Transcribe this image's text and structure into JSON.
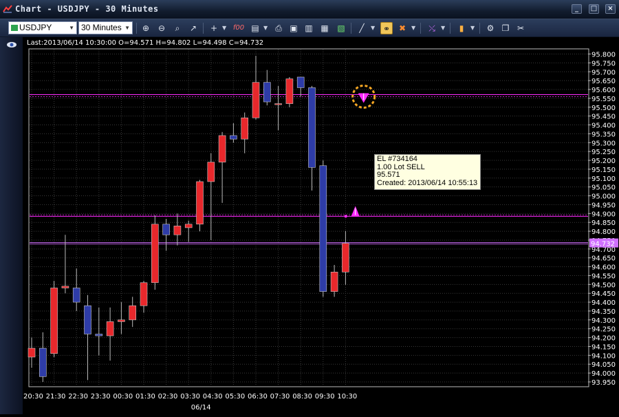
{
  "window": {
    "title": "Chart - USDJPY - 30 Minutes"
  },
  "toolbar": {
    "symbol": "USDJPY",
    "timeframe": "30 Minutes",
    "tools": [
      "zoom-in",
      "zoom-out",
      "zoom-fit",
      "cursor",
      "crosshair",
      "fx-indicators",
      "chart-type",
      "print",
      "save",
      "properties",
      "export",
      "line-tool",
      "link-tool",
      "delete-tool",
      "trendline",
      "candlestick",
      "settings",
      "copy",
      "tools"
    ]
  },
  "status_line": "Last:2013/06/14 10:30:00 O=94.571 H=94.802 L=94.498 C=94.732",
  "price_axis": {
    "min": 93.95,
    "max": 95.8,
    "step": 0.05,
    "labels": [
      "95.800",
      "95.750",
      "95.700",
      "95.650",
      "95.600",
      "95.550",
      "95.500",
      "95.450",
      "95.400",
      "95.350",
      "95.300",
      "95.250",
      "95.200",
      "95.150",
      "95.100",
      "95.050",
      "95.000",
      "94.950",
      "94.900",
      "94.850",
      "94.800",
      "94.750",
      "94.700",
      "94.650",
      "94.600",
      "94.550",
      "94.500",
      "94.450",
      "94.400",
      "94.350",
      "94.300",
      "94.250",
      "94.200",
      "94.150",
      "94.100",
      "94.050",
      "94.000",
      "93.950"
    ]
  },
  "current_price": {
    "value": 94.732,
    "label": "94.732"
  },
  "order_line": {
    "price": 95.571
  },
  "entry_line": {
    "price": 94.884
  },
  "time_axis": {
    "labels": [
      "20:30",
      "21:30",
      "22:30",
      "23:30",
      "00:30",
      "01:30",
      "02:30",
      "03:30",
      "04:30",
      "05:30",
      "06:30",
      "07:30",
      "08:30",
      "09:30",
      "10:30"
    ],
    "date_label": "06/14",
    "date_label_index": 8
  },
  "tooltip": {
    "line1": "EL #734164",
    "line2": "1.00 Lot SELL",
    "line3": "95.571",
    "line4": "Created: 2013/06/14 10:55:13"
  },
  "colors": {
    "bull": "#e8282c",
    "bear": "#2e3ca8",
    "marker": "#ff2bff",
    "order_circle": "#f5a623",
    "grid": "#3a3a3a"
  },
  "chart_data": {
    "type": "candlestick",
    "symbol": "USDJPY",
    "timeframe": "30 Minutes",
    "candles": [
      {
        "t": "20:00",
        "o": 94.09,
        "h": 94.2,
        "l": 94.03,
        "c": 94.14
      },
      {
        "t": "20:30",
        "o": 94.14,
        "h": 94.23,
        "l": 93.95,
        "c": 93.98
      },
      {
        "t": "21:00",
        "o": 94.11,
        "h": 94.52,
        "l": 94.09,
        "c": 94.48
      },
      {
        "t": "21:30",
        "o": 94.48,
        "h": 94.78,
        "l": 94.45,
        "c": 94.49
      },
      {
        "t": "22:00",
        "o": 94.48,
        "h": 94.59,
        "l": 94.35,
        "c": 94.4
      },
      {
        "t": "22:30",
        "o": 94.38,
        "h": 94.44,
        "l": 93.96,
        "c": 94.22
      },
      {
        "t": "23:00",
        "o": 94.22,
        "h": 94.37,
        "l": 94.1,
        "c": 94.21
      },
      {
        "t": "23:30",
        "o": 94.21,
        "h": 94.37,
        "l": 94.07,
        "c": 94.29
      },
      {
        "t": "00:00",
        "o": 94.29,
        "h": 94.4,
        "l": 94.22,
        "c": 94.3
      },
      {
        "t": "00:30",
        "o": 94.3,
        "h": 94.43,
        "l": 94.26,
        "c": 94.38
      },
      {
        "t": "01:00",
        "o": 94.38,
        "h": 94.52,
        "l": 94.34,
        "c": 94.51
      },
      {
        "t": "01:30",
        "o": 94.51,
        "h": 94.89,
        "l": 94.47,
        "c": 94.84
      },
      {
        "t": "02:00",
        "o": 94.84,
        "h": 94.87,
        "l": 94.69,
        "c": 94.78
      },
      {
        "t": "02:30",
        "o": 94.78,
        "h": 94.9,
        "l": 94.72,
        "c": 94.83
      },
      {
        "t": "03:00",
        "o": 94.82,
        "h": 94.86,
        "l": 94.74,
        "c": 94.84
      },
      {
        "t": "03:30",
        "o": 94.84,
        "h": 95.09,
        "l": 94.8,
        "c": 95.08
      },
      {
        "t": "04:00",
        "o": 95.08,
        "h": 95.24,
        "l": 94.75,
        "c": 95.19
      },
      {
        "t": "04:30",
        "o": 95.19,
        "h": 95.36,
        "l": 94.96,
        "c": 95.34
      },
      {
        "t": "05:00",
        "o": 95.34,
        "h": 95.41,
        "l": 95.3,
        "c": 95.32
      },
      {
        "t": "05:30",
        "o": 95.32,
        "h": 95.47,
        "l": 95.24,
        "c": 95.44
      },
      {
        "t": "06:00",
        "o": 95.44,
        "h": 95.79,
        "l": 95.43,
        "c": 95.64
      },
      {
        "t": "06:30",
        "o": 95.64,
        "h": 95.71,
        "l": 95.51,
        "c": 95.53
      },
      {
        "t": "07:00",
        "o": 95.52,
        "h": 95.62,
        "l": 95.37,
        "c": 95.52
      },
      {
        "t": "07:30",
        "o": 95.52,
        "h": 95.67,
        "l": 95.5,
        "c": 95.66
      },
      {
        "t": "08:00",
        "o": 95.67,
        "h": 95.66,
        "l": 95.56,
        "c": 95.61
      },
      {
        "t": "08:30",
        "o": 95.61,
        "h": 95.62,
        "l": 95.03,
        "c": 95.16
      },
      {
        "t": "09:00",
        "o": 95.17,
        "h": 95.2,
        "l": 94.43,
        "c": 94.46
      },
      {
        "t": "09:30",
        "o": 94.46,
        "h": 94.61,
        "l": 94.43,
        "c": 94.57
      },
      {
        "t": "10:00",
        "o": 94.57,
        "h": 94.802,
        "l": 94.498,
        "c": 94.732
      }
    ]
  }
}
